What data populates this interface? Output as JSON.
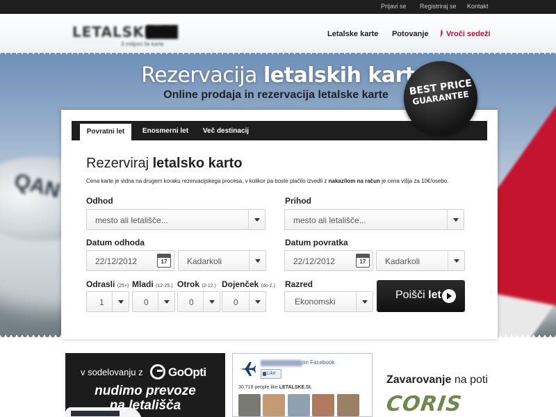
{
  "topbar": {
    "login": "Prijavi se",
    "register": "Registriraj se",
    "contact": "Kontakt"
  },
  "header": {
    "logo_text": "LETALSKE.SI",
    "logo_sub": "3 milijoni še karte",
    "nav": {
      "flights": "Letalske karte",
      "travel": "Potovanje",
      "hot": "Vroči sedeži"
    },
    "accent_color": "#c4102b"
  },
  "hero": {
    "title_light": "Rezervacija",
    "title_bold": "letalskih kart",
    "subtitle": "Online prodaja in rezervacija letalske karte",
    "badge_line1": "BEST PRICE",
    "badge_line2": "GUARANTEE"
  },
  "tabs": [
    {
      "label": "Povratni let",
      "active": true
    },
    {
      "label": "Enosmerni let",
      "active": false
    },
    {
      "label": "Več destinacij",
      "active": false
    }
  ],
  "form": {
    "title_light": "Rezerviraj",
    "title_bold": "letalsko karto",
    "note_before": "Cena karte je vidna na drugem koraku rezervacijskega procesa, v kolikor pa boste plačilo izvedli z ",
    "note_bold": "nakazilom na račun",
    "note_after": " je cena višja za 10€/osebo.",
    "departure": {
      "label": "Odhod",
      "placeholder": "mesto ali letališče..."
    },
    "arrival": {
      "label": "Prihod",
      "placeholder": "mesto ali letališče..."
    },
    "depart_date": {
      "label": "Datum odhoda",
      "value": "22/12/2012",
      "time": "Kadarkoli"
    },
    "return_date": {
      "label": "Datum povratka",
      "value": "22/12/2012",
      "time": "Kadarkoli"
    },
    "calendar_day": "17",
    "adults": {
      "label": "Odrasli",
      "hint": "(25+)",
      "value": "1"
    },
    "youth": {
      "label": "Mladi",
      "hint": "(12-25.)",
      "value": "0"
    },
    "children": {
      "label": "Otrok",
      "hint": "(2-12.)",
      "value": "0"
    },
    "infants": {
      "label": "Dojenček",
      "hint": "(do 2.)",
      "value": "0"
    },
    "class": {
      "label": "Razred",
      "value": "Ekonomski"
    },
    "search_light": "Poišči",
    "search_bold": "let"
  },
  "promo": {
    "line1": "v sodelovanju z",
    "brand": "GoOpti",
    "line2": "nudimo prevoze",
    "line3": "na letališča"
  },
  "facebook": {
    "on_facebook": "on Facebook",
    "like": "Like",
    "count_text": "30,718 people like",
    "count_name": "LETALSKE.SI."
  },
  "insurance": {
    "title_bold": "Zavarovanje",
    "title_light": "na poti",
    "logo": "CORIS"
  }
}
